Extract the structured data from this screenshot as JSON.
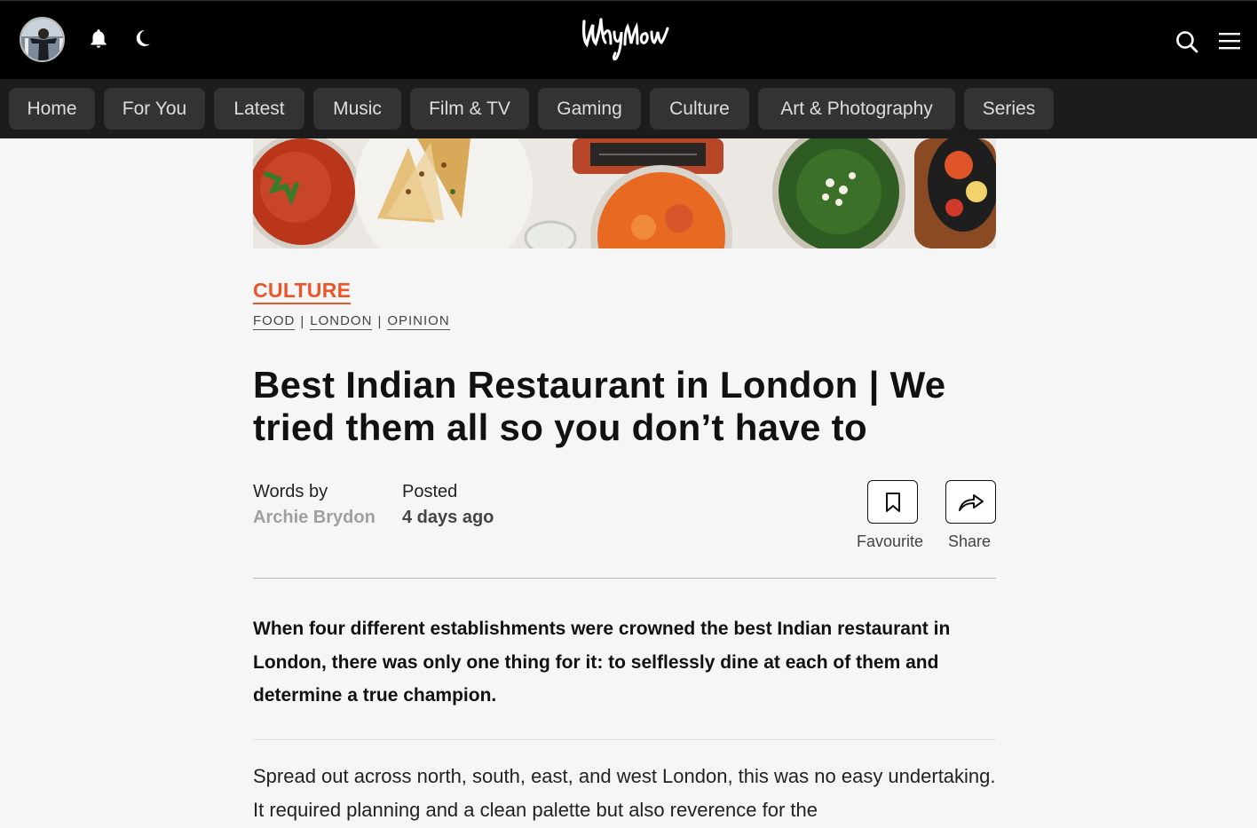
{
  "header": {
    "icons": [
      "avatar",
      "bell-icon",
      "moon-icon",
      "logo",
      "search-icon",
      "menu-icon"
    ],
    "logo_text": "Whynow"
  },
  "nav": {
    "items": [
      "Home",
      "For You",
      "Latest",
      "Music",
      "Film & TV",
      "Gaming",
      "Culture",
      "Art & Photography",
      "Series"
    ]
  },
  "article": {
    "category": "CULTURE",
    "tags": [
      "FOOD",
      "LONDON",
      "OPINION"
    ],
    "tag_separator": "|",
    "title": "Best Indian Restaurant in London | We tried them all so you don’t have to",
    "words_by_label": "Words by",
    "author": "Archie Brydon",
    "posted_label": "Posted",
    "posted_value": "4 days ago",
    "favourite_label": "Favourite",
    "share_label": "Share",
    "lead": "When four different establishments were crowned the best Indian restaurant in London, there was only one thing for it: to selflessly dine at each of them and determine a true champion.",
    "body": "Spread out across north, south, east, and west London, this was no easy undertaking. It required planning and a clean palette but also reverence for the"
  },
  "colors": {
    "accent": "#e8562a",
    "topbar": "#000000",
    "navbar": "#1c1c1c",
    "nav_pill": "#333333",
    "author": "#a0a0a0",
    "page_bg": "#f6f6f6"
  }
}
